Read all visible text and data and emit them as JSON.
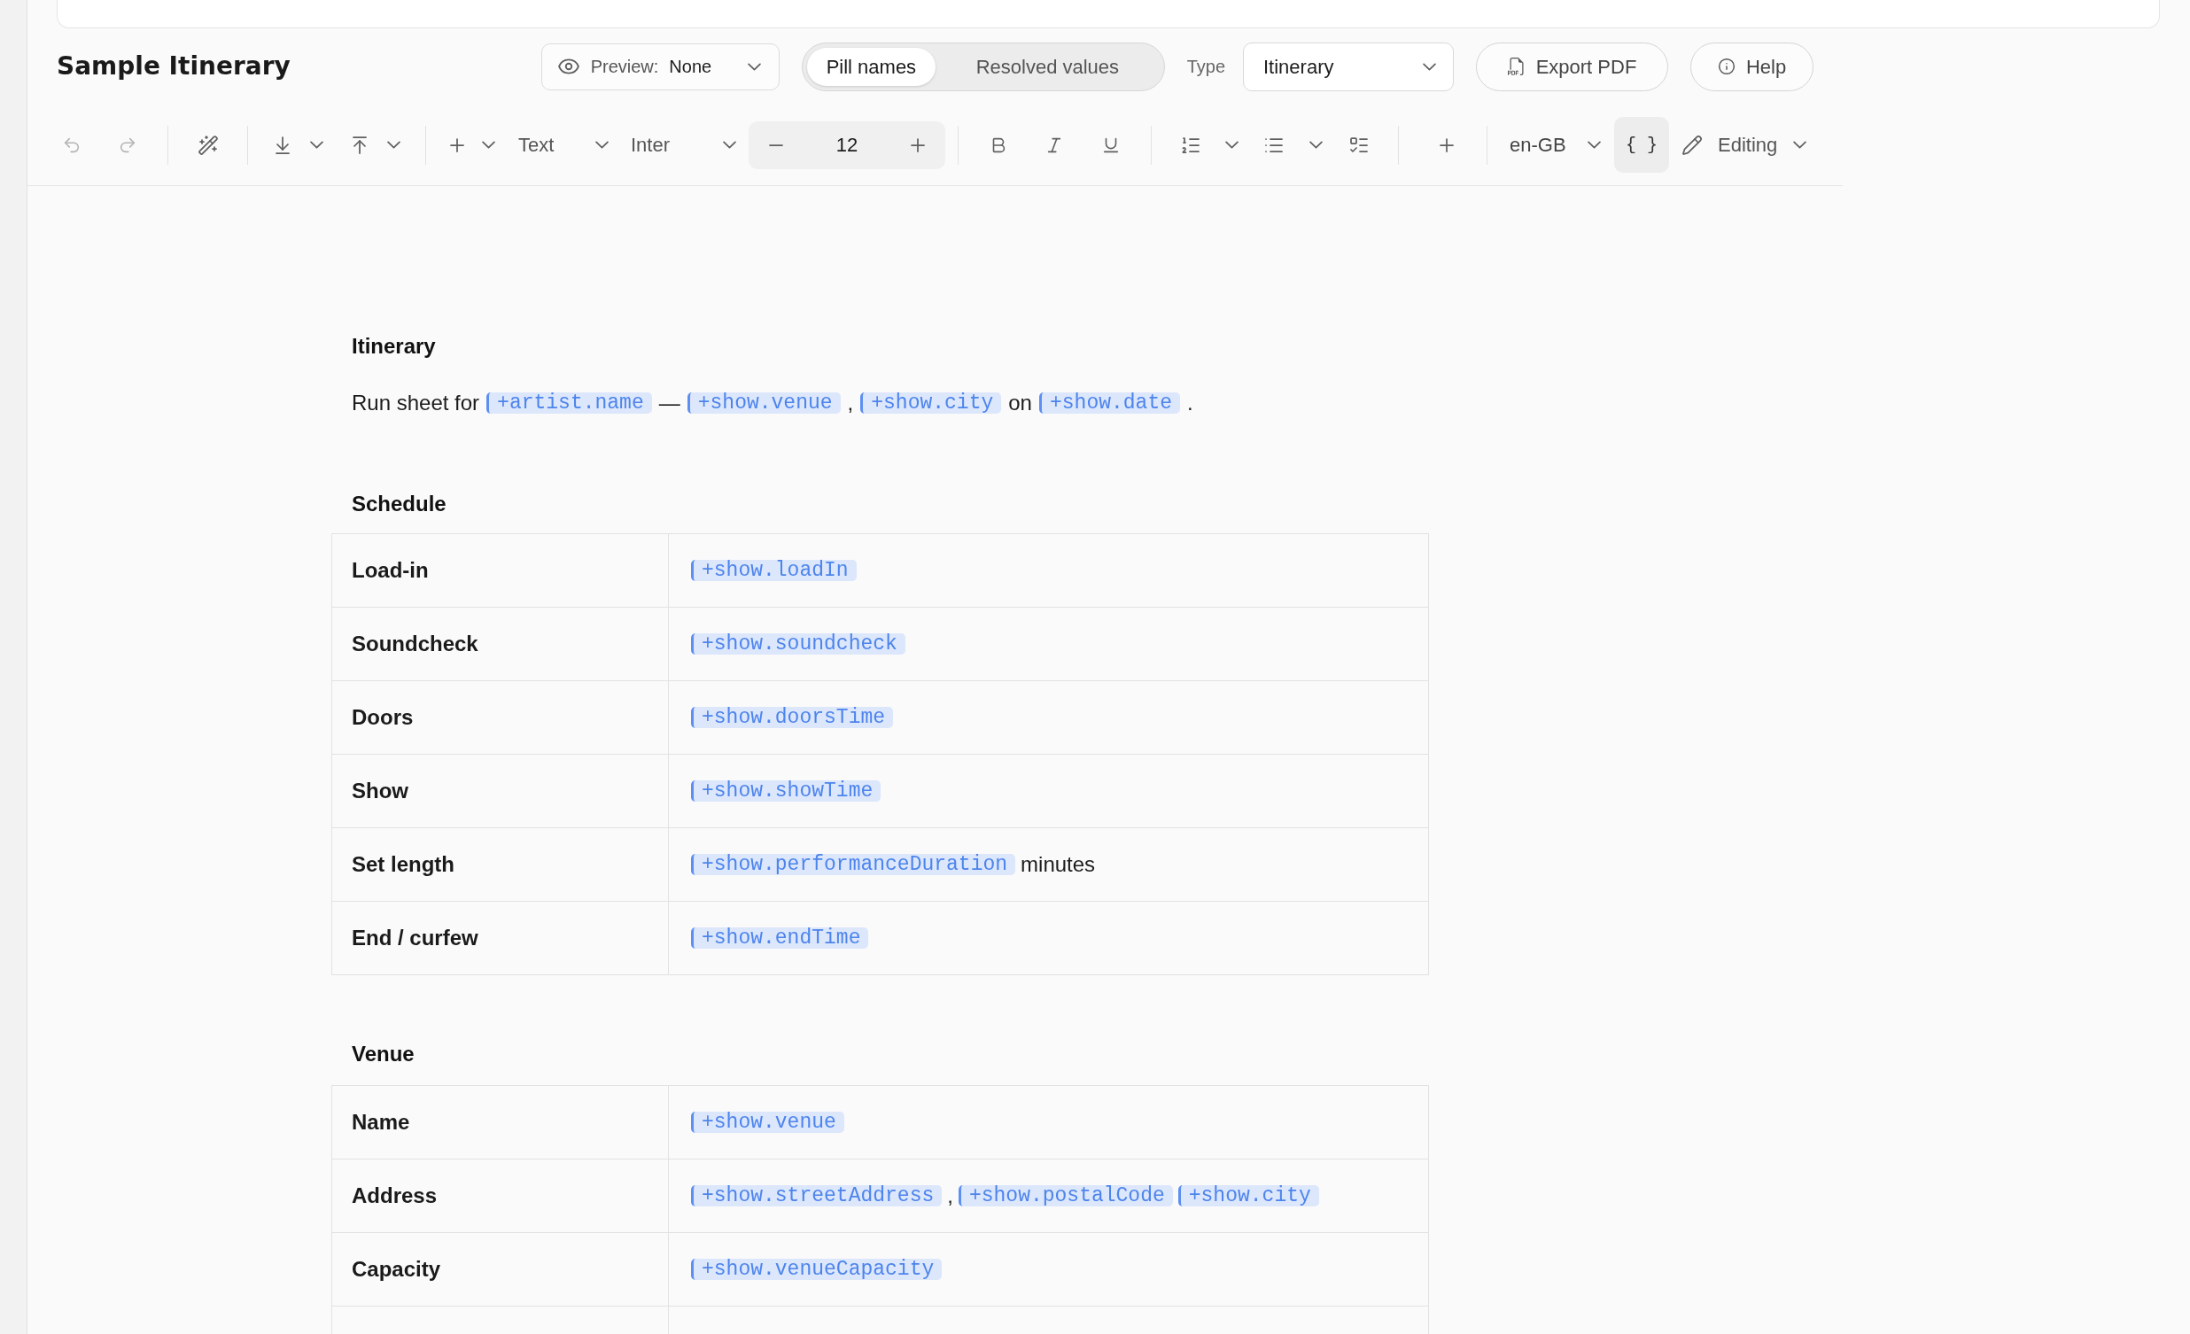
{
  "document_title": "Sample Itinerary",
  "header": {
    "preview": {
      "label": "Preview:",
      "value": "None"
    },
    "view_modes": [
      {
        "label": "Pill names",
        "selected": true
      },
      {
        "label": "Resolved values",
        "selected": false
      }
    ],
    "type": {
      "label": "Type",
      "value": "Itinerary"
    },
    "buttons": [
      {
        "kind": "export",
        "label": "Export PDF"
      },
      {
        "kind": "help",
        "label": "Help"
      }
    ]
  },
  "toolbar": {
    "history": [
      {
        "kind": "undo",
        "disabled": true
      },
      {
        "kind": "redo",
        "disabled": true
      }
    ],
    "block_style": "Text",
    "font_family": "Inter",
    "font_size": "12",
    "language": "en-GB",
    "variables_toggle": {
      "label": "{ }",
      "selected": true
    },
    "mode": "Editing"
  },
  "document": {
    "title": "Itinerary",
    "intro": [
      {
        "kind": "text",
        "text": "Run sheet for"
      },
      {
        "kind": "pill",
        "text": "+artist.name"
      },
      {
        "kind": "text",
        "text": "—"
      },
      {
        "kind": "pill",
        "text": "+show.venue"
      },
      {
        "kind": "text",
        "text": ","
      },
      {
        "kind": "pill",
        "text": "+show.city"
      },
      {
        "kind": "text",
        "text": "on"
      },
      {
        "kind": "pill",
        "text": "+show.date"
      },
      {
        "kind": "text",
        "text": "."
      }
    ],
    "sections": [
      {
        "title": "Schedule",
        "rows": [
          {
            "label": "Load-in",
            "value": [
              {
                "kind": "pill",
                "text": "+show.loadIn"
              }
            ]
          },
          {
            "label": "Soundcheck",
            "value": [
              {
                "kind": "pill",
                "text": "+show.soundcheck"
              }
            ]
          },
          {
            "label": "Doors",
            "value": [
              {
                "kind": "pill",
                "text": "+show.doorsTime"
              }
            ]
          },
          {
            "label": "Show",
            "value": [
              {
                "kind": "pill",
                "text": "+show.showTime"
              }
            ]
          },
          {
            "label": "Set length",
            "value": [
              {
                "kind": "pill",
                "text": "+show.performanceDuration"
              },
              {
                "kind": "text",
                "text": "minutes"
              }
            ]
          },
          {
            "label": "End / curfew",
            "value": [
              {
                "kind": "pill",
                "text": "+show.endTime"
              }
            ]
          }
        ]
      },
      {
        "title": "Venue",
        "rows": [
          {
            "label": "Name",
            "value": [
              {
                "kind": "pill",
                "text": "+show.venue"
              }
            ]
          },
          {
            "label": "Address",
            "value": [
              {
                "kind": "pill",
                "text": "+show.streetAddress"
              },
              {
                "kind": "text",
                "text": ","
              },
              {
                "kind": "pill",
                "text": "+show.postalCode"
              },
              {
                "kind": "pill",
                "text": "+show.city"
              }
            ]
          },
          {
            "label": "Capacity",
            "value": [
              {
                "kind": "pill",
                "text": "+show.venueCapacity"
              }
            ]
          }
        ]
      }
    ]
  }
}
